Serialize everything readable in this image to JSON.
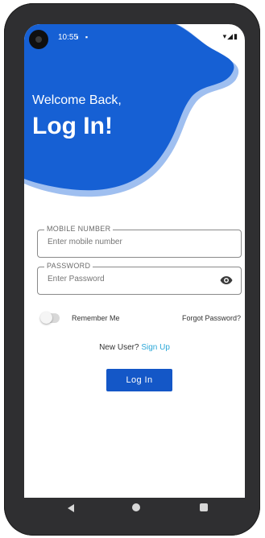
{
  "status_bar": {
    "time": "10:55",
    "left_icons": "◐ ▪",
    "right_icons": "▾◢▮"
  },
  "header": {
    "welcome": "Welcome Back,",
    "title": "Log In!"
  },
  "mobile_field": {
    "label": "MOBILE NUMBER",
    "placeholder": "Enter mobile number"
  },
  "password_field": {
    "label": "PASSWORD",
    "placeholder": "Enter Password",
    "icon": "eye-icon"
  },
  "options": {
    "remember_label": "Remember Me",
    "remember_checked": false,
    "forgot_label": "Forgot Password?"
  },
  "signup": {
    "prompt": "New User?",
    "link": "Sign Up"
  },
  "login_button": {
    "label": "Log In"
  },
  "colors": {
    "primary": "#1457c7",
    "header_blue": "#1660d4",
    "header_shadow": "#9fbff0",
    "link": "#2aa7d8"
  }
}
